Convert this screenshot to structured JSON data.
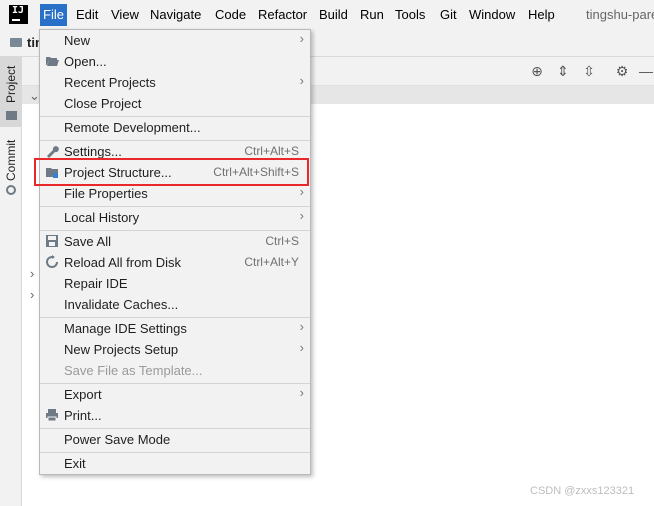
{
  "menubar": {
    "items": [
      "File",
      "Edit",
      "View",
      "Navigate",
      "Code",
      "Refactor",
      "Build",
      "Run",
      "Tools",
      "Git",
      "Window",
      "Help"
    ],
    "active_item": "File",
    "window_title": "tingshu-pare"
  },
  "navbar": {
    "project_name": "tingshu"
  },
  "left_strip": {
    "project_tab": "Project",
    "commit_tab": "Commit"
  },
  "file_menu": {
    "items": [
      {
        "label": "New",
        "shortcut": "",
        "submenu": true,
        "icon": ""
      },
      {
        "label": "Open...",
        "shortcut": "",
        "submenu": false,
        "icon": "folder-open-icon"
      },
      {
        "label": "Recent Projects",
        "shortcut": "",
        "submenu": true,
        "icon": ""
      },
      {
        "label": "Close Project",
        "shortcut": "",
        "submenu": false,
        "icon": ""
      },
      {
        "label": "Remote Development...",
        "shortcut": "",
        "submenu": false,
        "icon": ""
      },
      {
        "label": "Settings...",
        "shortcut": "Ctrl+Alt+S",
        "submenu": false,
        "icon": "wrench-icon"
      },
      {
        "label": "Project Structure...",
        "shortcut": "Ctrl+Alt+Shift+S",
        "submenu": false,
        "icon": "project-structure-icon"
      },
      {
        "label": "File Properties",
        "shortcut": "",
        "submenu": true,
        "icon": ""
      },
      {
        "label": "Local History",
        "shortcut": "",
        "submenu": true,
        "icon": ""
      },
      {
        "label": "Save All",
        "shortcut": "Ctrl+S",
        "submenu": false,
        "icon": "save-icon"
      },
      {
        "label": "Reload All from Disk",
        "shortcut": "Ctrl+Alt+Y",
        "submenu": false,
        "icon": "reload-icon"
      },
      {
        "label": "Repair IDE",
        "shortcut": "",
        "submenu": false,
        "icon": ""
      },
      {
        "label": "Invalidate Caches...",
        "shortcut": "",
        "submenu": false,
        "icon": ""
      },
      {
        "label": "Manage IDE Settings",
        "shortcut": "",
        "submenu": true,
        "icon": ""
      },
      {
        "label": "New Projects Setup",
        "shortcut": "",
        "submenu": true,
        "icon": ""
      },
      {
        "label": "Save File as Template...",
        "shortcut": "",
        "submenu": false,
        "icon": "",
        "disabled": true
      },
      {
        "label": "Export",
        "shortcut": "",
        "submenu": true,
        "icon": ""
      },
      {
        "label": "Print...",
        "shortcut": "",
        "submenu": false,
        "icon": "printer-icon"
      },
      {
        "label": "Power Save Mode",
        "shortcut": "",
        "submenu": false,
        "icon": ""
      },
      {
        "label": "Exit",
        "shortcut": "",
        "submenu": false,
        "icon": ""
      }
    ],
    "highlighted_item": "Project Structure..."
  },
  "watermark": "CSDN @zxxs123321",
  "colors": {
    "menu_active": "#2870c8",
    "highlight_box": "#e8282b",
    "menu_bg": "#f2f2f2"
  }
}
